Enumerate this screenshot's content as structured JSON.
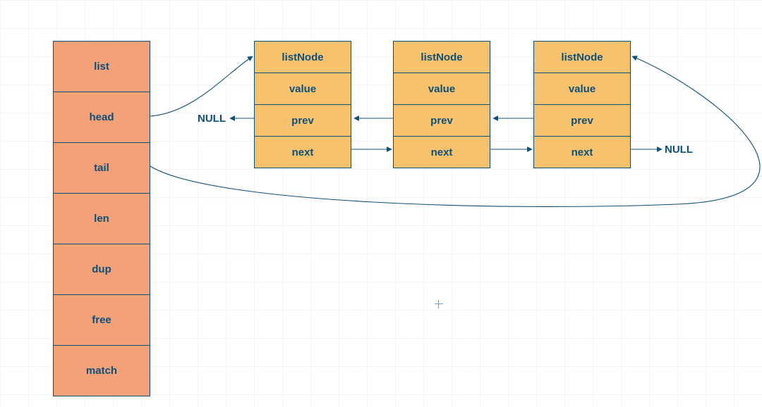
{
  "listStruct": {
    "fields": [
      "list",
      "head",
      "tail",
      "len",
      "dup",
      "free",
      "match"
    ]
  },
  "nodes": [
    {
      "title": "listNode",
      "value": "value",
      "prev": "prev",
      "next": "next"
    },
    {
      "title": "listNode",
      "value": "value",
      "prev": "prev",
      "next": "next"
    },
    {
      "title": "listNode",
      "value": "value",
      "prev": "prev",
      "next": "next"
    }
  ],
  "labels": {
    "nullLeft": "NULL",
    "nullRight": "NULL"
  },
  "colors": {
    "listFill": "#f2a179",
    "nodeFill": "#f7c26e",
    "line": "#0e4f78"
  }
}
